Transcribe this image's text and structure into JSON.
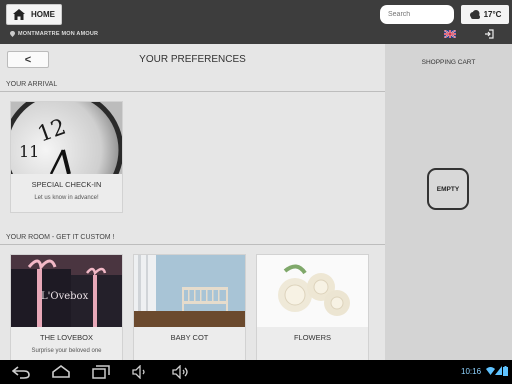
{
  "header": {
    "home_label": "HOME",
    "search_placeholder": "Search",
    "temperature": "17°C",
    "breadcrumb": "MONTMARTRE MON AMOUR"
  },
  "main": {
    "back_label": "<",
    "title": "YOUR PREFERENCES",
    "section_arrival": "YOUR ARRIVAL",
    "section_room": "YOUR ROOM - GET IT CUSTOM !",
    "arrival_cards": [
      {
        "title": "SPECIAL CHECK-IN",
        "subtitle": "Let us know in advance!"
      }
    ],
    "room_cards": [
      {
        "title": "THE LOVEBOX",
        "subtitle": "Surprise your beloved one",
        "image_text": "L'Ovebox"
      },
      {
        "title": "BABY COT",
        "subtitle": ""
      },
      {
        "title": "FLOWERS",
        "subtitle": ""
      }
    ]
  },
  "cart": {
    "title": "SHOPPING CART",
    "empty_label": "EMPTY"
  },
  "system_bar": {
    "time": "10:16"
  },
  "colors": {
    "topbar": "#3d3d3d",
    "panel": "#e6e6e6",
    "cart_bg": "#d4d4d4",
    "clock": "#8fd3ff"
  },
  "icons": [
    "home-icon",
    "cloud-icon",
    "location-pin-icon",
    "uk-flag-icon",
    "logout-icon",
    "back-nav-icon",
    "home-nav-icon",
    "recents-icon",
    "volume-down-icon",
    "volume-up-icon",
    "wifi-icon",
    "signal-icon",
    "battery-icon"
  ]
}
